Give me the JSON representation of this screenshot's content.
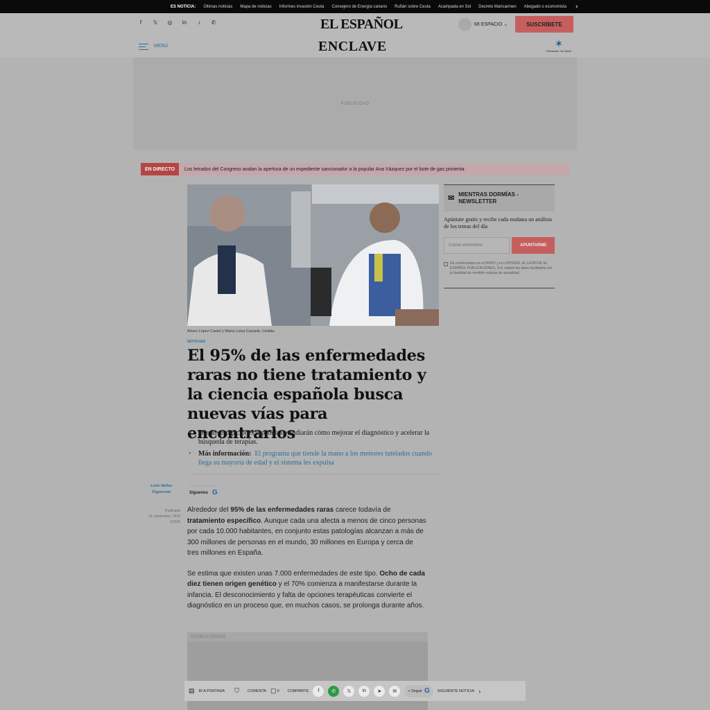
{
  "topbar": {
    "label": "ES NOTICIA:",
    "items": [
      "Últimas noticias",
      "Mapa de noticias",
      "Informes invasión Ceuta",
      "Consejero de Energía canario",
      "Rufián sobre Ceuta",
      "Acampada en Sol",
      "Decreto Maricarmen",
      "Abogado o economista"
    ]
  },
  "header": {
    "social_icons": [
      "facebook-icon",
      "x-icon",
      "instagram-icon",
      "linkedin-icon",
      "tiktok-icon",
      "whatsapp-icon"
    ],
    "social_glyphs": [
      "f",
      "𝕏",
      "◎",
      "in",
      "♪",
      "✆"
    ],
    "logo": "EL ESPAÑOL",
    "my_space": "MI ESPACIO",
    "subscribe": "SUSCRÍBETE",
    "menu": "MENÚ",
    "section_logo": "ENCLAVE",
    "partner": "Fundación \"la Caixa\""
  },
  "ad": {
    "label": "PUBLICIDAD"
  },
  "live": {
    "tag": "EN DIRECTO",
    "text": "Los letrados del Congreso avalan la apertura de un expediente sancionador a la popular Ana Vázquez por el bote de gas pimienta"
  },
  "article": {
    "caption": "Arturo López Castel y María Luisa Cayuela.   Cedida.",
    "section": "NOTICIAS",
    "headline": "El 95% de las enfermedades raras no tiene tratamiento y la ciencia española busca nuevas vías para encontrarlos",
    "bullet1": "Dos investigaciones españolas estudiarán cómo mejorar el diagnóstico y acelerar la búsqueda de terapias.",
    "more_label": "Más información:",
    "more_link": "El programa que tiende la mano a los menores tutelados cuando llega su mayoría de edad y el sistema les expulsa",
    "author": "León Núñez Figueredo",
    "pub_label": "Publicada",
    "pub_date": "21 septiembre, 2024",
    "pub_time": "13:53h",
    "follow": "Síguenos",
    "p1_a": "Alrededor del ",
    "p1_b": "95% de las enfermedades raras",
    "p1_c": " carece todavía de ",
    "p1_d": "tratamiento específico",
    "p1_e": ". Aunque cada una afecta a menos de cinco personas por cada 10.000 habitantes, en conjunto estas patologías alcanzan a más de 300 millones de personas en el mundo, 30 millones en Europa y cerca de tres millones en España.",
    "p2_a": "Se estima que existen unas 7.000 enfermedades de este tipo. ",
    "p2_b": "Ocho de cada diez tienen origen genético",
    "p2_c": " y el 70% comienza a manifestarse durante la infancia. El desconocimiento y falta de opciones terapéuticas convierte el diagnóstico en un proceso que, en muchos casos, se prolonga durante años.",
    "video_label": "ÚLTIMOS VÍDEOS"
  },
  "newsletter": {
    "title": "MIENTRAS DORMÍAS - NEWSLETTER",
    "subtitle": "Apúntate gratis y recibe cada mañana un análisis de los temas del día",
    "placeholder": "Correo electrónico",
    "button": "APUNTARME",
    "legal": "De conformidad con el RGPD y la LOPDGDD, EL LEÓN DE EL ESPAÑOL PUBLICACIONES, S.A. tratará los datos facilitados con la finalidad de remitirle noticias de actualidad."
  },
  "bottombar": {
    "home": "IR A PORTADA",
    "comment": "COMENTA",
    "comment_count": "0",
    "share": "COMPARTE",
    "follow": "+ Seguir",
    "next": "SIGUIENTE NOTICIA"
  }
}
